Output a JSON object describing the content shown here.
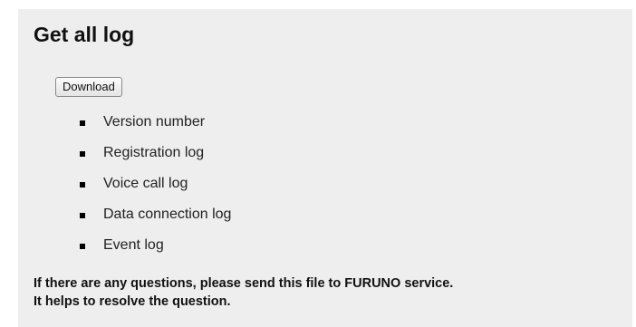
{
  "section": {
    "title": "Get all log",
    "download_label": "Download",
    "items": [
      "Version number",
      "Registration log",
      "Voice call log",
      "Data connection log",
      "Event log"
    ],
    "notice_line_1": "If there are any questions, please send this file to FURUNO service.",
    "notice_line_2": "It helps to resolve the question."
  },
  "colors": {
    "panel_background": "#eeeeee",
    "text": "#111111"
  }
}
